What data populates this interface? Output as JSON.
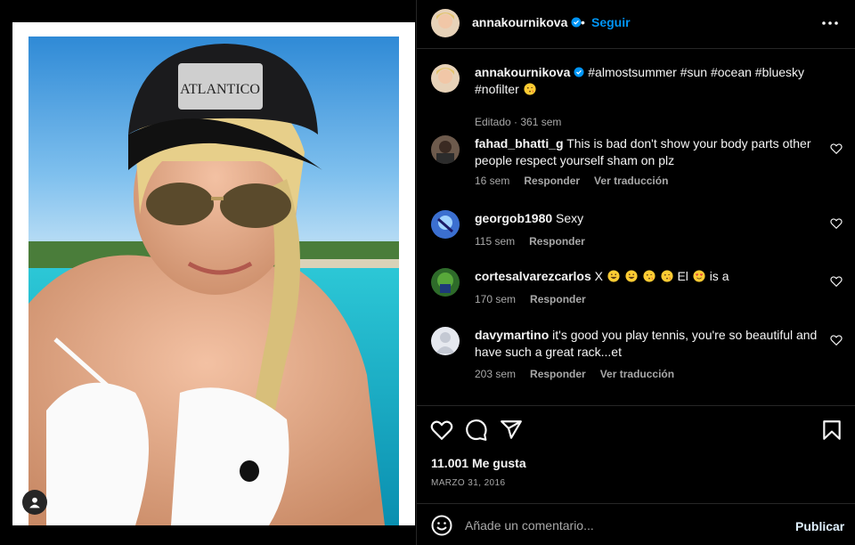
{
  "colors": {
    "background": "#000000",
    "link": "#0095f6",
    "muted": "#a8a8a8",
    "verified": "#0095f6"
  },
  "post": {
    "author": "annakournikova",
    "follow_label": "Seguir",
    "dot": "•",
    "more_icon": "more-horizontal-icon",
    "verified_icon": "verified-badge-icon",
    "image_icon_tag": "user-tag-icon"
  },
  "caption": {
    "username": "annakournikova",
    "text": "#almostsummer #sun #ocean #bluesky #nofilter",
    "meta": "Editado · 361 sem"
  },
  "comments": [
    {
      "username": "fahad_bhatti_g",
      "text": "This is bad don't show your body parts other people respect yourself sham on plz",
      "time": "16 sem",
      "reply": "Responder",
      "translate": "Ver traducción"
    },
    {
      "username": "georgob1980",
      "text": "Sexy",
      "time": "115 sem",
      "reply": "Responder",
      "translate": ""
    },
    {
      "username": "cortesalvarezcarlos",
      "text_parts": [
        "X",
        "El",
        "is a"
      ],
      "time": "170 sem",
      "reply": "Responder",
      "translate": ""
    },
    {
      "username": "davymartino",
      "text": "it's good you play tennis, you're so beautiful and have such a great rack...et",
      "time": "203 sem",
      "reply": "Responder",
      "translate": "Ver traducción"
    }
  ],
  "actions": {
    "icons": [
      "heart-icon",
      "comment-icon",
      "share-icon",
      "bookmark-icon"
    ]
  },
  "likes": "11.001 Me gusta",
  "date": "MARZO 31, 2016",
  "add_comment": {
    "placeholder": "Añade un comentario...",
    "publish_label": "Publicar",
    "emoji_icon": "emoji-icon"
  }
}
